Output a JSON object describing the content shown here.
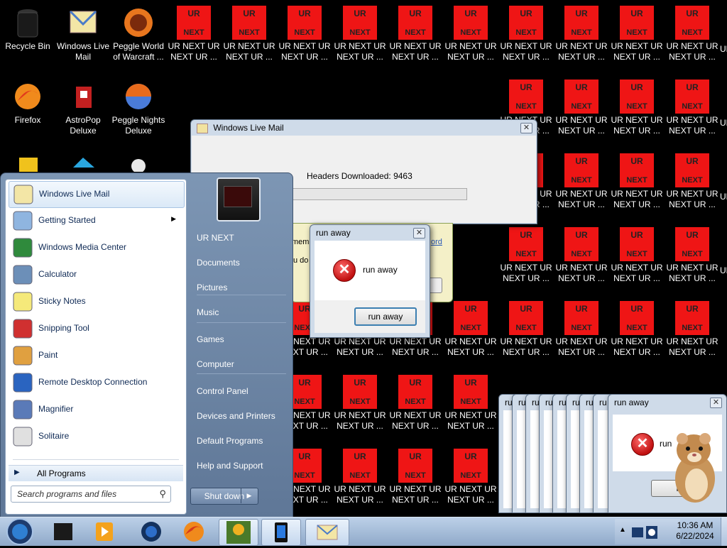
{
  "desktop": {
    "icons": [
      {
        "label": "Recycle Bin",
        "icon": "recycle-bin-icon"
      },
      {
        "label": "Windows Live Mail",
        "icon": "windows-live-mail-icon"
      },
      {
        "label": "Peggle World of Warcraft ...",
        "icon": "peggle-wow-icon"
      },
      {
        "label": "Firefox",
        "icon": "firefox-icon"
      },
      {
        "label": "AstroPop Deluxe",
        "icon": "astropop-icon"
      },
      {
        "label": "Peggle Nights Deluxe",
        "icon": "peggle-nights-icon"
      }
    ],
    "ur_icon": {
      "top_text": "UR",
      "bottom_text": "NEXT",
      "label_line1": "UR NEXT UR",
      "label_line2": "NEXT UR ...",
      "color": "#ef1515"
    }
  },
  "live_mail_window": {
    "title": "Windows Live Mail",
    "status": "Headers Downloaded: 9463",
    "progress_fraction": 0.0
  },
  "behind_dialog": {
    "fragment_1": "membe",
    "fragment_2": "u do",
    "fragment_3": "ord"
  },
  "run_away_dialog": {
    "title": "run away",
    "message": "run away",
    "button": "run away"
  },
  "stacked_dialogs": {
    "title": "run away",
    "message_fragment": "run",
    "button_fragment": "ru",
    "tab_fragment": "ru"
  },
  "start_menu": {
    "programs": [
      {
        "label": "Windows Live Mail",
        "icon": "windows-live-mail-icon"
      },
      {
        "label": "Getting Started",
        "icon": "getting-started-icon",
        "has_submenu": true
      },
      {
        "label": "Windows Media Center",
        "icon": "media-center-icon"
      },
      {
        "label": "Calculator",
        "icon": "calculator-icon"
      },
      {
        "label": "Sticky Notes",
        "icon": "sticky-notes-icon"
      },
      {
        "label": "Snipping Tool",
        "icon": "snipping-tool-icon"
      },
      {
        "label": "Paint",
        "icon": "paint-icon"
      },
      {
        "label": "Remote Desktop Connection",
        "icon": "remote-desktop-icon"
      },
      {
        "label": "Magnifier",
        "icon": "magnifier-icon"
      },
      {
        "label": "Solitaire",
        "icon": "solitaire-icon"
      }
    ],
    "all_programs": "All Programs",
    "search_placeholder": "Search programs and files",
    "right_items": [
      "UR NEXT",
      "Documents",
      "Pictures",
      "Music",
      "Games",
      "Computer",
      "Control Panel",
      "Devices and Printers",
      "Default Programs",
      "Help and Support"
    ],
    "shutdown": "Shut down"
  },
  "taskbar": {
    "time": "10:36 AM",
    "date": "6/22/2024",
    "pinned": [
      "start-orb-icon",
      "app-icon",
      "media-player-icon",
      "globe-icon",
      "firefox-icon",
      "peggle-box-icon",
      "phone-icon",
      "windows-live-mail-icon"
    ]
  }
}
